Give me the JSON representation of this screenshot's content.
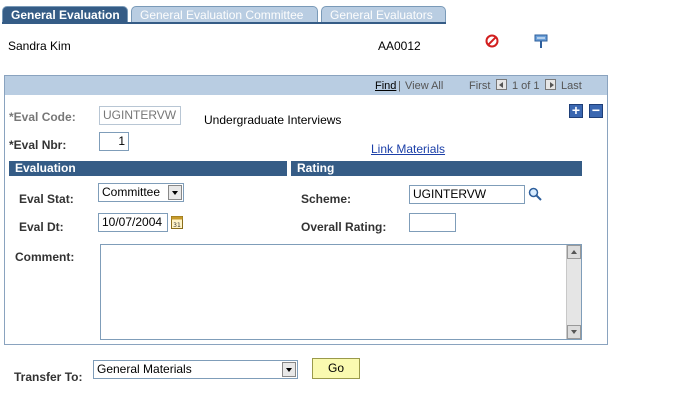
{
  "tabs": [
    "General Evaluation",
    "General Evaluation Committee",
    "General Evaluators"
  ],
  "header": {
    "name": "Sandra Kim",
    "id": "AA0012"
  },
  "panel_nav": {
    "find": "Find",
    "view_all": "View All",
    "first": "First",
    "range": "1 of 1",
    "last": "Last"
  },
  "eval_code": {
    "label": "*Eval Code:",
    "value": "UGINTERVW",
    "description": "Undergraduate Interviews"
  },
  "eval_nbr": {
    "label": "*Eval Nbr:",
    "value": "1"
  },
  "link_materials": "Link Materials",
  "evaluation": {
    "title": "Evaluation",
    "stat_label": "Eval Stat:",
    "stat_value": "Committee",
    "dt_label": "Eval Dt:",
    "dt_value": "10/07/2004"
  },
  "rating": {
    "title": "Rating",
    "scheme_label": "Scheme:",
    "scheme_value": "UGINTERVW",
    "overall_label": "Overall Rating:",
    "overall_value": ""
  },
  "comment": {
    "label": "Comment:",
    "value": ""
  },
  "transfer": {
    "label": "Transfer To:",
    "value": "General Materials",
    "go": "Go"
  },
  "colors": {
    "tab_active": "#355c86",
    "tab_inactive": "#b9cde2",
    "section_bar": "#355c86",
    "go_button": "#fafab0"
  }
}
